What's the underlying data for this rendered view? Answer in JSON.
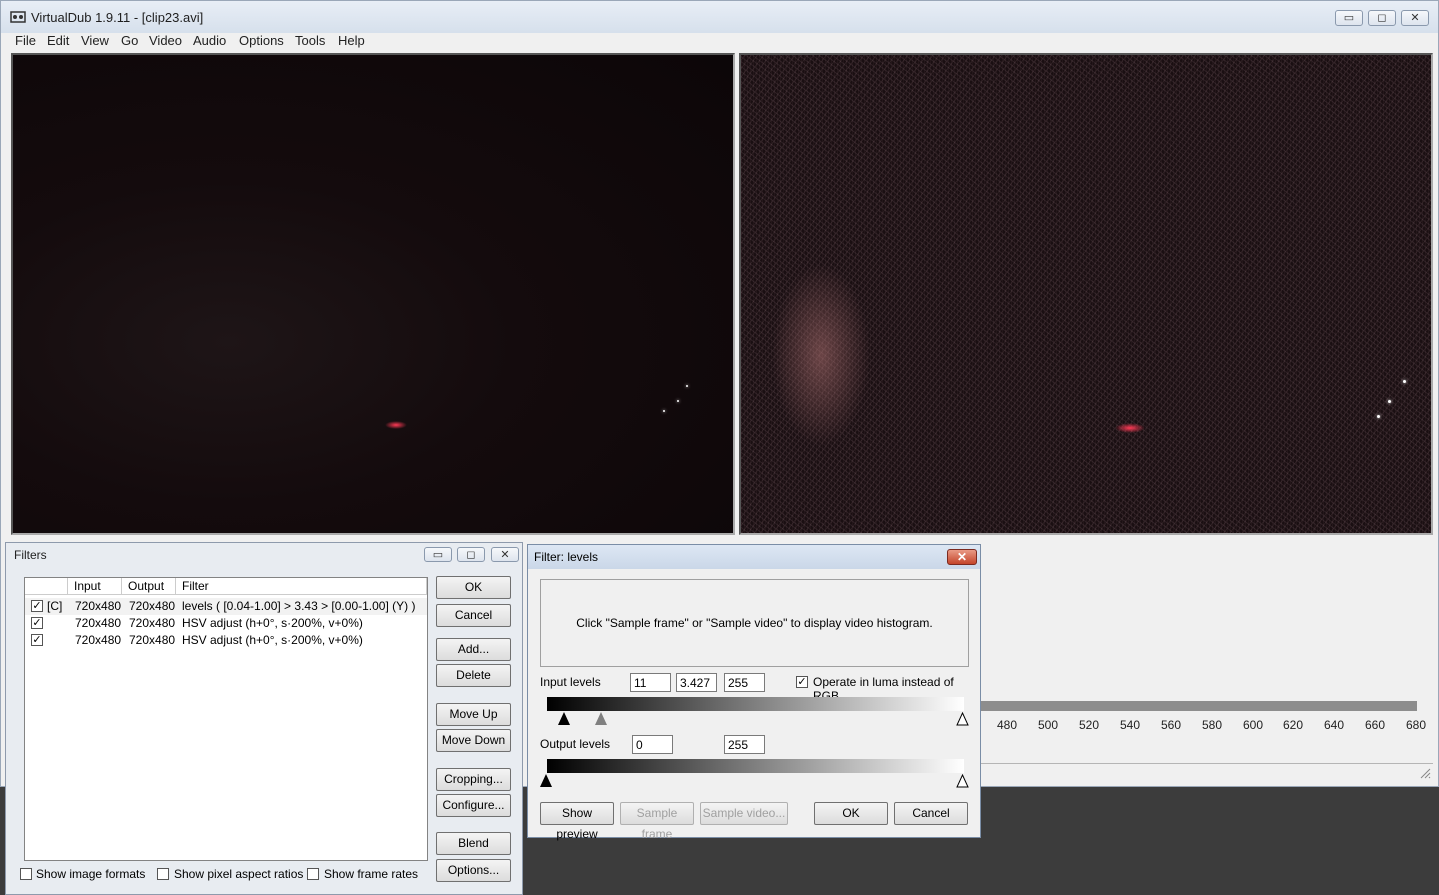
{
  "window": {
    "title": "VirtualDub 1.9.11 - [clip23.avi]",
    "controls": {
      "minimize": "▭",
      "maximize": "◻",
      "close": "✕"
    }
  },
  "menu": [
    "File",
    "Edit",
    "View",
    "Go",
    "Video",
    "Audio",
    "Options",
    "Tools",
    "Help"
  ],
  "timeline": {
    "ticks": [
      "480",
      "500",
      "520",
      "540",
      "560",
      "580",
      "600",
      "620",
      "640",
      "660",
      "680"
    ]
  },
  "filters_dialog": {
    "title": "Filters",
    "columns": [
      "Input",
      "Output",
      "Filter"
    ],
    "rows": [
      {
        "checked": true,
        "flag": "[C]",
        "input": "720x480",
        "output": "720x480",
        "filter": "levels ( [0.04-1.00] > 3.43 > [0.00-1.00] (Y) )"
      },
      {
        "checked": true,
        "flag": "",
        "input": "720x480",
        "output": "720x480",
        "filter": "HSV adjust (h+0°, s·200%, v+0%)"
      },
      {
        "checked": true,
        "flag": "",
        "input": "720x480",
        "output": "720x480",
        "filter": "HSV adjust (h+0°, s·200%, v+0%)"
      }
    ],
    "buttons": {
      "ok": "OK",
      "cancel": "Cancel",
      "add": "Add...",
      "delete": "Delete",
      "move_up": "Move Up",
      "move_down": "Move Down",
      "cropping": "Cropping...",
      "configure": "Configure...",
      "blend": "Blend",
      "options": "Options..."
    },
    "options": {
      "show_image_formats": "Show image formats",
      "show_pixel_aspect_ratios": "Show pixel aspect ratios",
      "show_frame_rates": "Show frame rates"
    }
  },
  "levels_dialog": {
    "title": "Filter: levels",
    "histogram_hint": "Click \"Sample frame\" or \"Sample video\" to display video histogram.",
    "input_label": "Input levels",
    "input_low": "11",
    "input_gamma": "3.427",
    "input_high": "255",
    "luma_label": "Operate in luma instead of RGB",
    "luma_checked": true,
    "output_label": "Output levels",
    "output_low": "0",
    "output_high": "255",
    "buttons": {
      "show_preview": "Show preview",
      "sample_frame": "Sample frame",
      "sample_video": "Sample video...",
      "ok": "OK",
      "cancel": "Cancel"
    }
  }
}
